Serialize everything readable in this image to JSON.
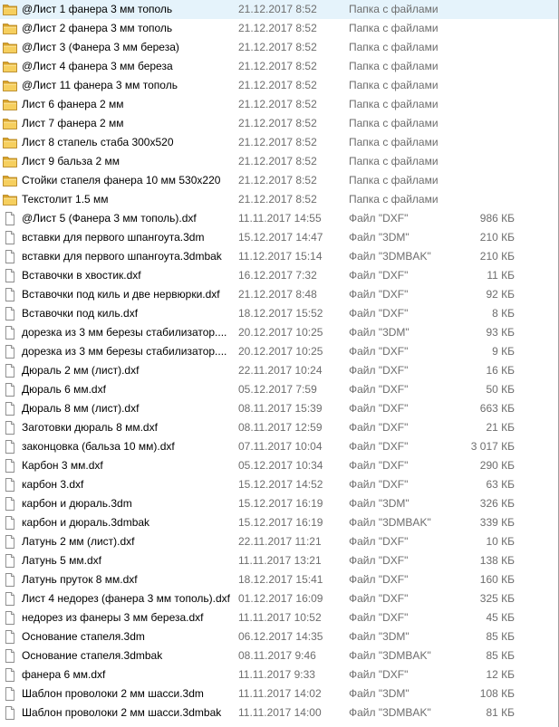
{
  "files": [
    {
      "name": "@Лист 1 фанера 3 мм тополь",
      "date": "21.12.2017 8:52",
      "type": "Папка с файлами",
      "size": "",
      "icon": "folder-icon"
    },
    {
      "name": "@Лист 2 фанера 3 мм тополь",
      "date": "21.12.2017 8:52",
      "type": "Папка с файлами",
      "size": "",
      "icon": "folder-icon"
    },
    {
      "name": "@Лист 3 (Фанера 3 мм береза)",
      "date": "21.12.2017 8:52",
      "type": "Папка с файлами",
      "size": "",
      "icon": "folder-icon"
    },
    {
      "name": "@Лист 4 фанера 3 мм береза",
      "date": "21.12.2017 8:52",
      "type": "Папка с файлами",
      "size": "",
      "icon": "folder-icon"
    },
    {
      "name": "@Лист 11 фанера 3 мм тополь",
      "date": "21.12.2017 8:52",
      "type": "Папка с файлами",
      "size": "",
      "icon": "folder-icon"
    },
    {
      "name": "Лист 6 фанера 2 мм",
      "date": "21.12.2017 8:52",
      "type": "Папка с файлами",
      "size": "",
      "icon": "folder-icon"
    },
    {
      "name": "Лист 7 фанера 2 мм",
      "date": "21.12.2017 8:52",
      "type": "Папка с файлами",
      "size": "",
      "icon": "folder-icon"
    },
    {
      "name": "Лист 8 стапель стаба 300х520",
      "date": "21.12.2017 8:52",
      "type": "Папка с файлами",
      "size": "",
      "icon": "folder-icon"
    },
    {
      "name": "Лист 9 бальза 2 мм",
      "date": "21.12.2017 8:52",
      "type": "Папка с файлами",
      "size": "",
      "icon": "folder-icon"
    },
    {
      "name": "Стойки стапеля фанера 10 мм 530х220",
      "date": "21.12.2017 8:52",
      "type": "Папка с файлами",
      "size": "",
      "icon": "folder-icon"
    },
    {
      "name": "Текстолит 1.5 мм",
      "date": "21.12.2017 8:52",
      "type": "Папка с файлами",
      "size": "",
      "icon": "folder-icon"
    },
    {
      "name": "@Лист 5 (Фанера 3 мм тополь).dxf",
      "date": "11.11.2017 14:55",
      "type": "Файл \"DXF\"",
      "size": "986 КБ",
      "icon": "file-icon"
    },
    {
      "name": "вставки для первого шпангоута.3dm",
      "date": "15.12.2017 14:47",
      "type": "Файл \"3DM\"",
      "size": "210 КБ",
      "icon": "file-icon"
    },
    {
      "name": "вставки для первого шпангоута.3dmbak",
      "date": "11.12.2017 15:14",
      "type": "Файл \"3DMBAK\"",
      "size": "210 КБ",
      "icon": "file-icon"
    },
    {
      "name": "Вставочки в хвостик.dxf",
      "date": "16.12.2017 7:32",
      "type": "Файл \"DXF\"",
      "size": "11 КБ",
      "icon": "file-icon"
    },
    {
      "name": "Вставочки под киль и две нервюрки.dxf",
      "date": "21.12.2017 8:48",
      "type": "Файл \"DXF\"",
      "size": "92 КБ",
      "icon": "file-icon"
    },
    {
      "name": "Вставочки под киль.dxf",
      "date": "18.12.2017 15:52",
      "type": "Файл \"DXF\"",
      "size": "8 КБ",
      "icon": "file-icon"
    },
    {
      "name": "дорезка из 3 мм березы стабилизатор....",
      "date": "20.12.2017 10:25",
      "type": "Файл \"3DM\"",
      "size": "93 КБ",
      "icon": "file-icon"
    },
    {
      "name": "дорезка из 3 мм березы стабилизатор....",
      "date": "20.12.2017 10:25",
      "type": "Файл \"DXF\"",
      "size": "9 КБ",
      "icon": "file-icon"
    },
    {
      "name": "Дюраль 2 мм (лист).dxf",
      "date": "22.11.2017 10:24",
      "type": "Файл \"DXF\"",
      "size": "16 КБ",
      "icon": "file-icon"
    },
    {
      "name": "Дюраль 6 мм.dxf",
      "date": "05.12.2017 7:59",
      "type": "Файл \"DXF\"",
      "size": "50 КБ",
      "icon": "file-icon"
    },
    {
      "name": "Дюраль 8 мм (лист).dxf",
      "date": "08.11.2017 15:39",
      "type": "Файл \"DXF\"",
      "size": "663 КБ",
      "icon": "file-icon"
    },
    {
      "name": "Заготовки дюраль 8 мм.dxf",
      "date": "08.11.2017 12:59",
      "type": "Файл \"DXF\"",
      "size": "21 КБ",
      "icon": "file-icon"
    },
    {
      "name": "законцовка (бальза 10 мм).dxf",
      "date": "07.11.2017 10:04",
      "type": "Файл \"DXF\"",
      "size": "3 017 КБ",
      "icon": "file-icon"
    },
    {
      "name": "Карбон 3 мм.dxf",
      "date": "05.12.2017 10:34",
      "type": "Файл \"DXF\"",
      "size": "290 КБ",
      "icon": "file-icon"
    },
    {
      "name": "карбон 3.dxf",
      "date": "15.12.2017 14:52",
      "type": "Файл \"DXF\"",
      "size": "63 КБ",
      "icon": "file-icon"
    },
    {
      "name": "карбон и дюраль.3dm",
      "date": "15.12.2017 16:19",
      "type": "Файл \"3DM\"",
      "size": "326 КБ",
      "icon": "file-icon"
    },
    {
      "name": "карбон и дюраль.3dmbak",
      "date": "15.12.2017 16:19",
      "type": "Файл \"3DMBAK\"",
      "size": "339 КБ",
      "icon": "file-icon"
    },
    {
      "name": "Латунь 2 мм (лист).dxf",
      "date": "22.11.2017 11:21",
      "type": "Файл \"DXF\"",
      "size": "10 КБ",
      "icon": "file-icon"
    },
    {
      "name": "Латунь 5 мм.dxf",
      "date": "11.11.2017 13:21",
      "type": "Файл \"DXF\"",
      "size": "138 КБ",
      "icon": "file-icon"
    },
    {
      "name": "Латунь пруток 8 мм.dxf",
      "date": "18.12.2017 15:41",
      "type": "Файл \"DXF\"",
      "size": "160 КБ",
      "icon": "file-icon"
    },
    {
      "name": "Лист 4 недорез (фанера 3 мм тополь).dxf",
      "date": "01.12.2017 16:09",
      "type": "Файл \"DXF\"",
      "size": "325 КБ",
      "icon": "file-icon"
    },
    {
      "name": "недорез из фанеры 3 мм береза.dxf",
      "date": "11.11.2017 10:52",
      "type": "Файл \"DXF\"",
      "size": "45 КБ",
      "icon": "file-icon"
    },
    {
      "name": "Основание стапеля.3dm",
      "date": "06.12.2017 14:35",
      "type": "Файл \"3DM\"",
      "size": "85 КБ",
      "icon": "file-icon"
    },
    {
      "name": "Основание стапеля.3dmbak",
      "date": "08.11.2017 9:46",
      "type": "Файл \"3DMBAK\"",
      "size": "85 КБ",
      "icon": "file-icon"
    },
    {
      "name": "фанера 6 мм.dxf",
      "date": "11.11.2017 9:33",
      "type": "Файл \"DXF\"",
      "size": "12 КБ",
      "icon": "file-icon"
    },
    {
      "name": "Шаблон проволоки 2 мм шасси.3dm",
      "date": "11.11.2017 14:02",
      "type": "Файл \"3DM\"",
      "size": "108 КБ",
      "icon": "file-icon"
    },
    {
      "name": "Шаблон проволоки 2 мм шасси.3dmbak",
      "date": "11.11.2017 14:00",
      "type": "Файл \"3DMBAK\"",
      "size": "81 КБ",
      "icon": "file-icon"
    }
  ]
}
